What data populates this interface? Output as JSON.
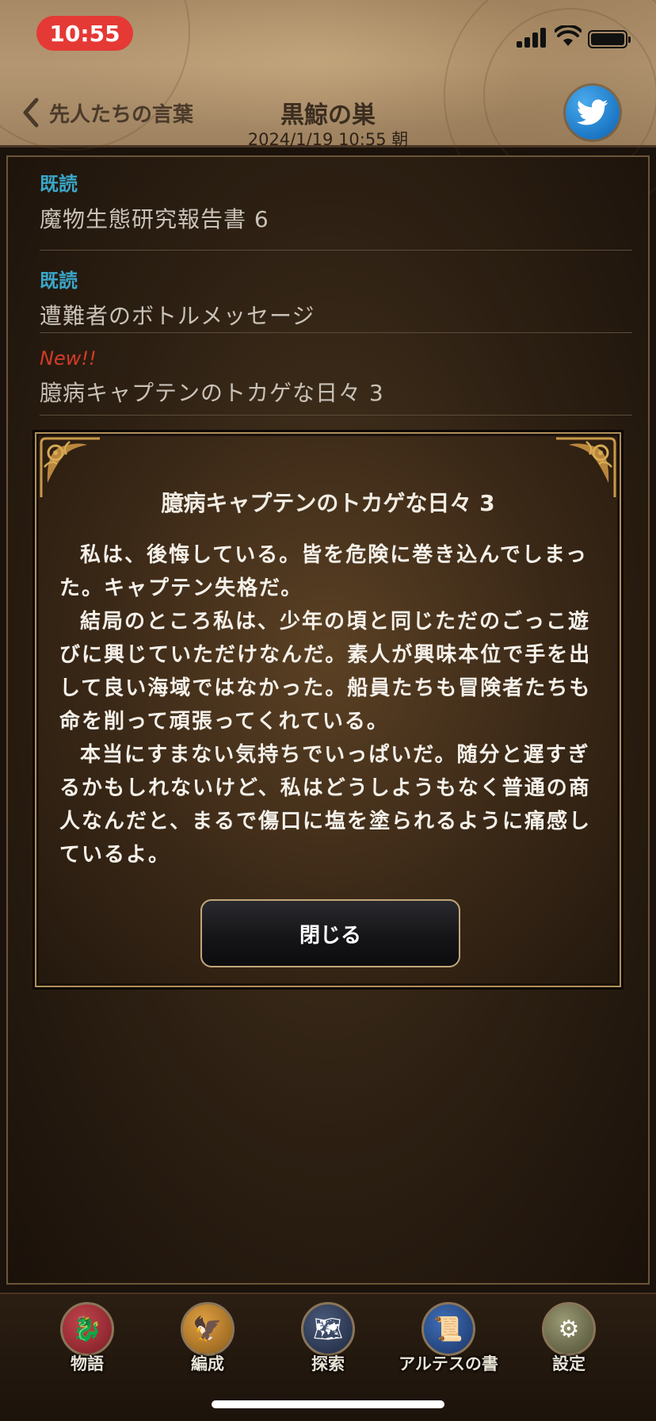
{
  "status_bar": {
    "time": "10:55"
  },
  "header": {
    "back_label": "先人たちの言葉",
    "title": "黒鯨の巣",
    "datetime": "2024/1/19  10:55 朝"
  },
  "list": [
    {
      "badge": "既読",
      "badge_type": "read",
      "title": "魔物生態研究報告書 6"
    },
    {
      "badge": "既読",
      "badge_type": "read",
      "title": "遭難者のボトルメッセージ"
    },
    {
      "badge": "New!!",
      "badge_type": "new",
      "title": "臆病キャプテンのトカゲな日々 3"
    }
  ],
  "dialog": {
    "title": "臆病キャプテンのトカゲな日々 3",
    "paragraphs": [
      "私は、後悔している。皆を危険に巻き込んでしまった。キャプテン失格だ。",
      "結局のところ私は、少年の頃と同じただのごっこ遊びに興じていただけなんだ。素人が興味本位で手を出して良い海域ではなかった。船員たちも冒険者たちも命を削って頑張ってくれている。",
      "本当にすまない気持ちでいっぱいだ。随分と遅すぎるかもしれないけど、私はどうしようもなく普通の商人なんだと、まるで傷口に塩を塗られるように痛感しているよ。"
    ],
    "close_label": "閉じる"
  },
  "tabs": [
    {
      "label": "物語",
      "icon": "story-icon"
    },
    {
      "label": "編成",
      "icon": "formation-icon"
    },
    {
      "label": "探索",
      "icon": "explore-icon"
    },
    {
      "label": "アルテスの書",
      "icon": "book-icon"
    },
    {
      "label": "設定",
      "icon": "settings-icon"
    }
  ],
  "colors": {
    "read_badge": "#3aa6c8",
    "new_badge": "#d23c28",
    "status_time_bg": "#e53935",
    "twitter": "#1d9bf0"
  }
}
